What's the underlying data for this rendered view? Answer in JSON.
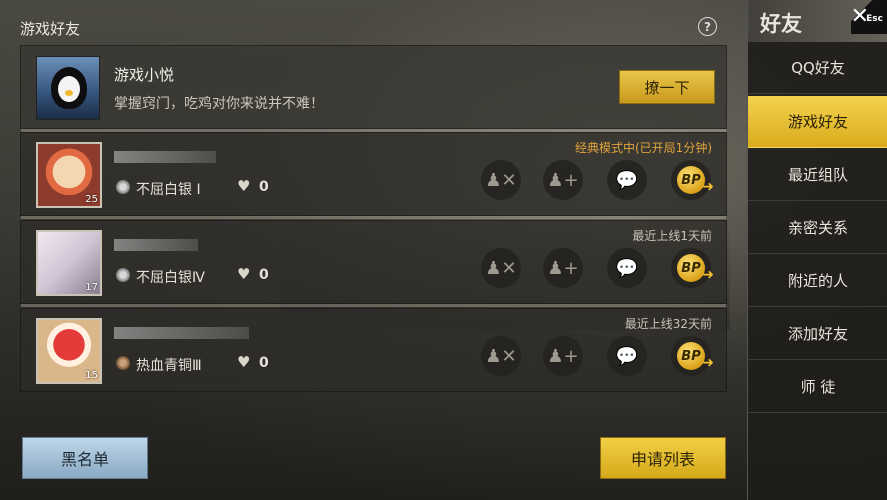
{
  "header": {
    "title": "游戏好友",
    "help_icon": "?"
  },
  "bot": {
    "name": "游戏小悦",
    "message": "掌握窍门，吃鸡对你来说并不难！",
    "poke_label": "撩一下"
  },
  "friends": [
    {
      "status": "经典模式中(已开局1分钟)",
      "rank": "不屈白银 Ⅰ",
      "likes": "0",
      "level": "25",
      "rank_badge": "Ⅰ"
    },
    {
      "status": "最近上线1天前",
      "rank": "不屈白银Ⅳ",
      "likes": "0",
      "level": "17",
      "rank_badge": "Ⅳ"
    },
    {
      "status": "最近上线32天前",
      "rank": "热血青铜Ⅲ",
      "likes": "0",
      "level": "15",
      "rank_badge": "Ⅲ"
    }
  ],
  "footer": {
    "blacklist_label": "黑名单",
    "requests_label": "申请列表"
  },
  "sidebar": {
    "title": "好友",
    "esc_label": "Esc",
    "items": [
      {
        "label": "QQ好友",
        "active": false
      },
      {
        "label": "游戏好友",
        "active": true
      },
      {
        "label": "最近组队",
        "active": false
      },
      {
        "label": "亲密关系",
        "active": false
      },
      {
        "label": "附近的人",
        "active": false
      },
      {
        "label": "添加好友",
        "active": false
      },
      {
        "label": "师 徒",
        "active": false
      }
    ]
  },
  "icons": {
    "remove": "remove-friend-icon",
    "add_team": "add-team-icon",
    "chat": "chat-icon",
    "gift": "bp-coin-icon",
    "heart": "heart-icon"
  }
}
